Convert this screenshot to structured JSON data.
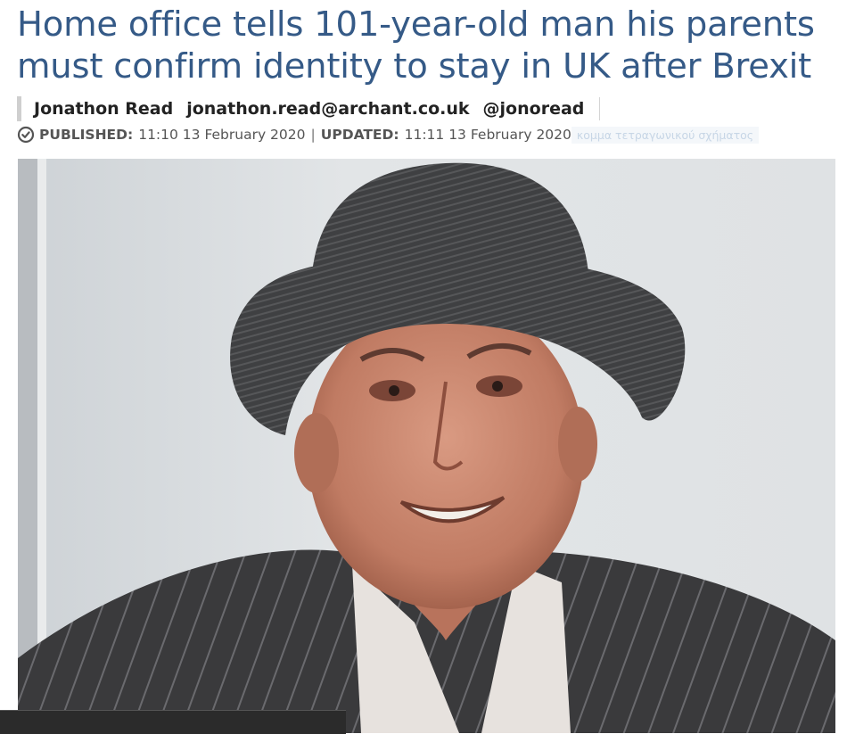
{
  "article": {
    "headline": "Home office tells 101-year-old man his parents must confirm identity to stay in UK after Brexit",
    "author_name": "Jonathon Read",
    "author_email": "jonathon.read@archant.co.uk",
    "author_twitter": "@jonoread",
    "published_label": "PUBLISHED:",
    "published_time": "11:10 13 February 2020",
    "separator": "|",
    "updated_label": "UPDATED:",
    "updated_time": "11:11 13 February 2020",
    "overlay_text": "κομμα τετραγωνικού σχήματος"
  },
  "icons": {
    "clock": "clock-icon"
  },
  "colors": {
    "headline": "#355a87",
    "byline_text": "#222222",
    "meta_text": "#555555",
    "bottom_bar": "#2b2b2b"
  }
}
